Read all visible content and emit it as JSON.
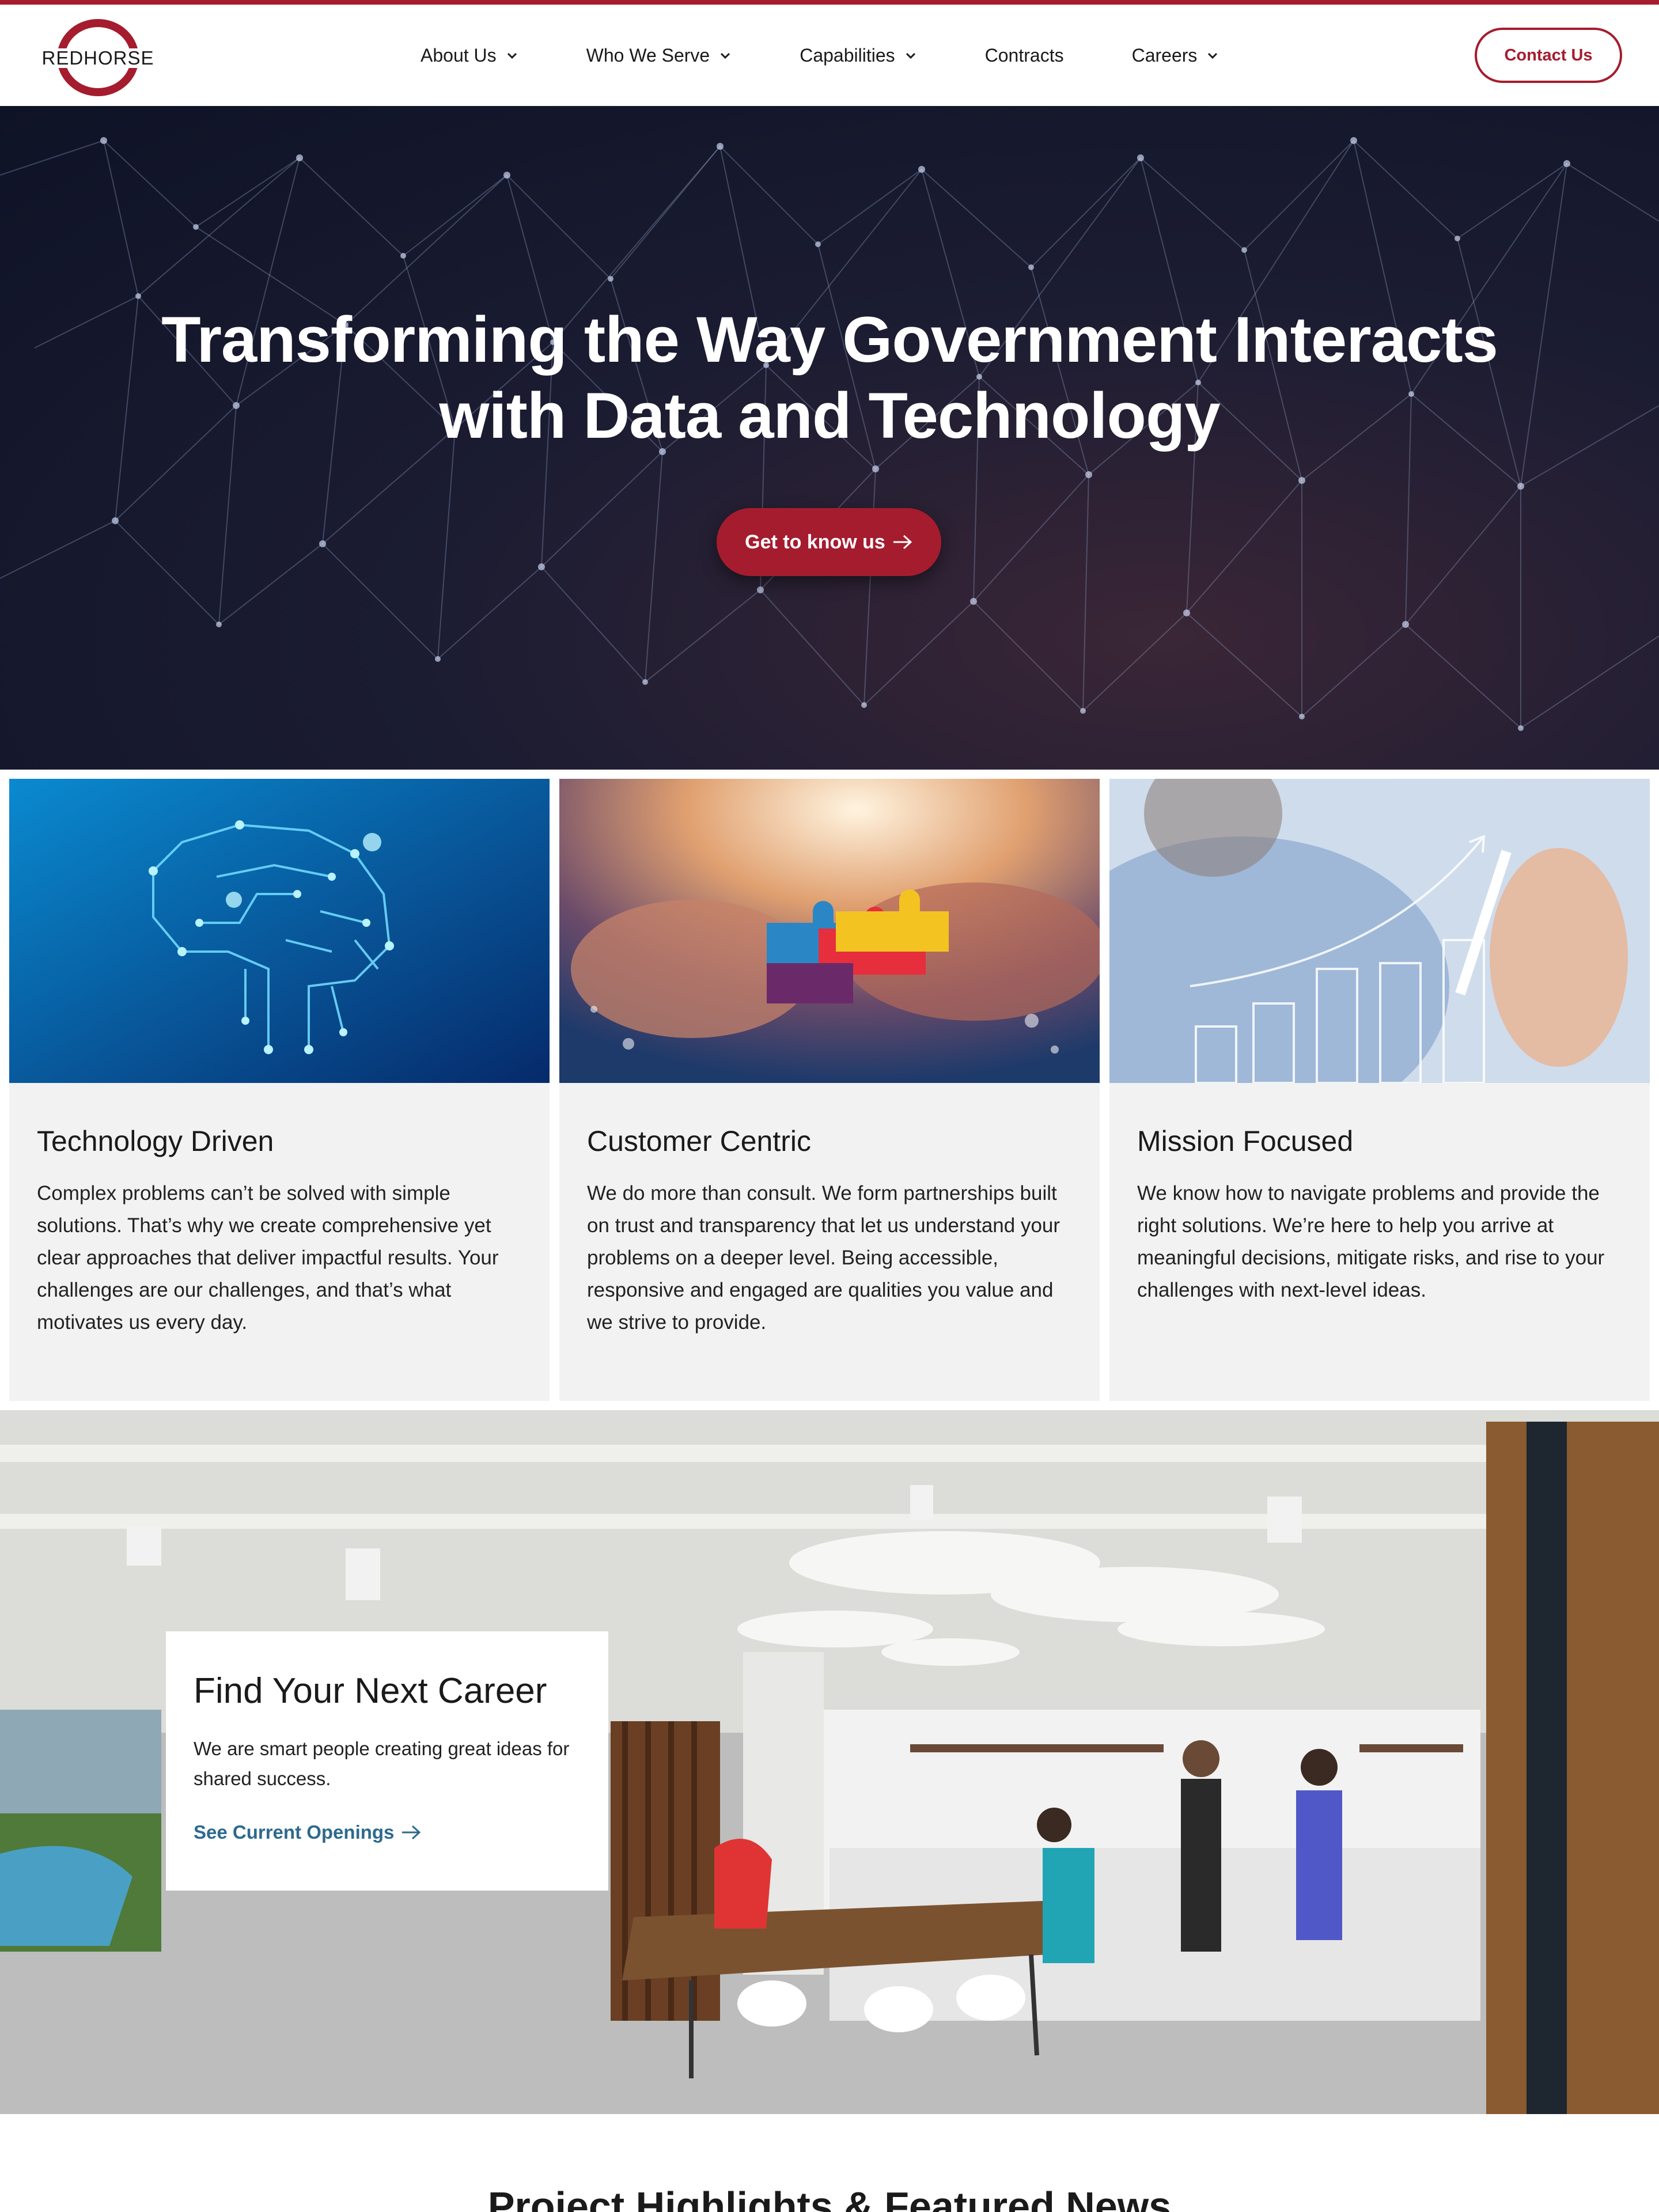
{
  "brand": {
    "logo_text": "REDHORSE",
    "accent_color": "#a51c2e",
    "link_color": "#2d6a8e"
  },
  "nav": {
    "items": [
      {
        "label": "About Us",
        "has_dropdown": true
      },
      {
        "label": "Who We Serve",
        "has_dropdown": true
      },
      {
        "label": "Capabilities",
        "has_dropdown": true
      },
      {
        "label": "Contracts",
        "has_dropdown": false
      },
      {
        "label": "Careers",
        "has_dropdown": true
      }
    ],
    "contact_label": "Contact Us"
  },
  "hero": {
    "title_line1": "Transforming the Way Government Interacts",
    "title_line2": "with Data and Technology",
    "cta_label": "Get to know us"
  },
  "cards": [
    {
      "image": "circuit-brain-image",
      "title": "Technology Driven",
      "body": "Complex problems can’t be solved with simple solutions. That’s why we create comprehensive yet clear approaches that deliver impactful results. Your challenges are our challenges, and that’s what motivates us every day."
    },
    {
      "image": "puzzle-pieces-image",
      "title": "Customer Centric",
      "body": "We do more than consult. We form partnerships built on trust and transparency that let us understand your problems on a deeper level. Being accessible, responsive and engaged are qualities you value and we strive to provide."
    },
    {
      "image": "growth-chart-image",
      "title": "Mission Focused",
      "body": "We know how to navigate problems and provide the right solutions. We’re here to help you arrive at meaningful decisions, mitigate risks, and rise to your challenges with next-level ideas."
    }
  ],
  "careers": {
    "title": "Find Your Next Career",
    "body": "We are smart people creating great ideas for shared success.",
    "link_label": "See Current Openings"
  },
  "news": {
    "title": "Project Highlights & Featured News"
  }
}
